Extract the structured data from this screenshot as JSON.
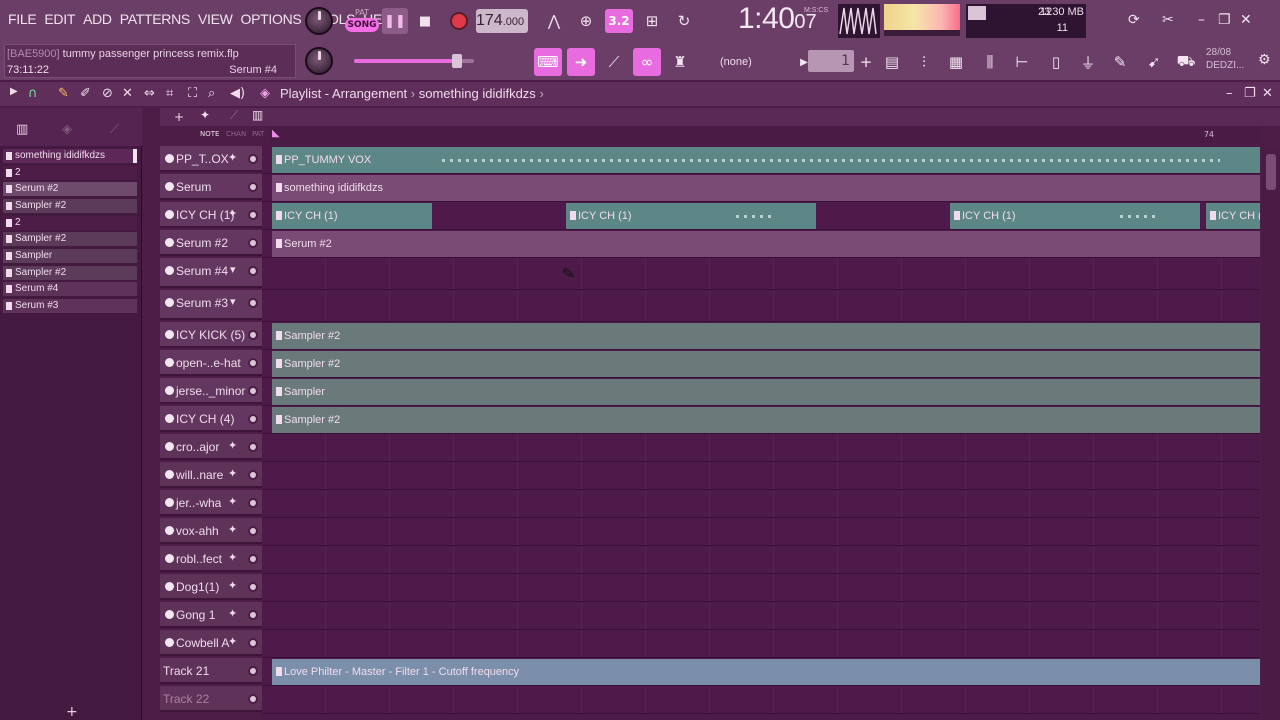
{
  "menu": [
    "FILE",
    "EDIT",
    "ADD",
    "PATTERNS",
    "VIEW",
    "OPTIONS",
    "TOOLS",
    "HELP"
  ],
  "transport": {
    "pat_label": "PAT",
    "song_label": "SONG",
    "tempo_int": "174",
    "tempo_dec": ".000",
    "pattern_step": "3.2"
  },
  "clock": {
    "main": "1:40",
    "sub": "07",
    "label": "M:S:CS"
  },
  "cpu": {
    "value": "23",
    "memory": "1230 MB",
    "polyphony": "11"
  },
  "song": {
    "file_prefix": "[BAE5900]",
    "file_name": "tummy passenger princess remix.flp",
    "time": "73:11:22",
    "focused_plugin": "Serum #4"
  },
  "toolbar2": {
    "snap_value": "(none)",
    "pattern_number": "1"
  },
  "news": {
    "date": "28/08",
    "name": "DEDZI..."
  },
  "playlist": {
    "title": "Playlist - Arrangement",
    "pattern": "something ididifkdzs",
    "tab_note": "NOTE",
    "tab_chan": "CHAN",
    "tab_pat": "PAT",
    "ruler_bar": "74"
  },
  "picker": [
    "something ididifkdzs",
    "2",
    "Serum #2",
    "Sampler #2",
    "2",
    "Sampler #2",
    "Sampler",
    "Sampler #2",
    "Serum #4",
    "Serum #3"
  ],
  "tracks": [
    "PP_T..OX",
    "Serum",
    "ICY CH (1)",
    "Serum #2",
    "Serum #4",
    "Serum #3",
    "ICY KICK (5)",
    "open-..e-hat",
    "jerse.._minor",
    "ICY CH (4)",
    "cro..ajor",
    "will..nare",
    "jer..-wha",
    "vox-ahh",
    "robl..fect",
    "Dog1(1)",
    "Gong 1",
    "Cowbell A",
    "Track 21",
    "Track 22"
  ],
  "clips": {
    "vox": "PP_TUMMY VOX",
    "serum": "something ididifkdzs",
    "icy": "ICY CH (1)",
    "serum2": "Serum #2",
    "sampler2": "Sampler #2",
    "sampler": "Sampler",
    "automation": "Love Philter - Master - Filter 1 - Cutoff frequency"
  }
}
